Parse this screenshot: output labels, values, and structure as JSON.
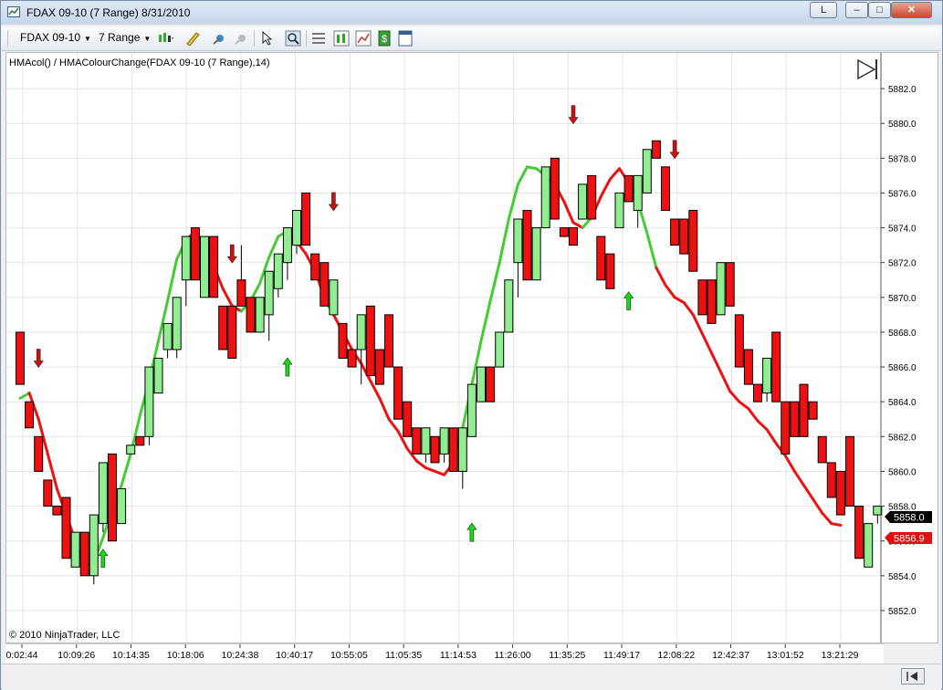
{
  "window": {
    "title": "FDAX 09-10 (7 Range)  8/31/2010",
    "buttons": {
      "link": "L",
      "minimize": "–",
      "maximize": "□",
      "close": "✕"
    }
  },
  "toolbar": {
    "instrument": "FDAX 09-10",
    "period": "7 Range",
    "icons": [
      "chart-style-icon",
      "drawing-tool-icon",
      "crosshair-icon",
      "global-crosshair-icon",
      "pointer-icon",
      "zoom-icon",
      "properties-icon",
      "indicators-icon",
      "strategies-icon",
      "orders-icon",
      "data-box-icon"
    ]
  },
  "chart": {
    "indicator_label": "HMAcol() / HMAColourChange(FDAX 09-10 (7 Range),14)",
    "copyright": "© 2010 NinjaTrader, LLC",
    "last_price_label": "5858.0",
    "indicator_price_label": "5856.9",
    "colors": {
      "bull": "#90ee90",
      "bear": "#ee1111",
      "hma_up": "#44cc33",
      "hma_down": "#ee1111",
      "up_arrow": "#11dd11",
      "down_arrow": "#cc1111"
    }
  },
  "chart_data": {
    "type": "candlestick",
    "ylim": [
      5851,
      5883
    ],
    "yticks": [
      "5852.0",
      "5854.0",
      "5856.0",
      "5858.0",
      "5860.0",
      "5862.0",
      "5864.0",
      "5866.0",
      "5868.0",
      "5870.0",
      "5872.0",
      "5874.0",
      "5876.0",
      "5878.0",
      "5880.0",
      "5882.0"
    ],
    "xticks": [
      "0:02:44",
      "10:09:26",
      "10:14:35",
      "10:18:06",
      "10:24:38",
      "10:40:17",
      "10:55:05",
      "11:05:35",
      "11:14:53",
      "11:26:00",
      "11:35:25",
      "11:49:17",
      "12:08:22",
      "12:42:37",
      "13:01:52",
      "13:21:29"
    ],
    "candles": [
      [
        5868,
        5868,
        5865,
        5865
      ],
      [
        5864,
        5864,
        5862.5,
        5862.5
      ],
      [
        5862,
        5862,
        5860,
        5860
      ],
      [
        5859.5,
        5859.5,
        5858,
        5858
      ],
      [
        5858,
        5858,
        5857.5,
        5857.5
      ],
      [
        5858.5,
        5858.5,
        5855,
        5855
      ],
      [
        5854.5,
        5856.5,
        5854.5,
        5856.5
      ],
      [
        5856.5,
        5856.5,
        5854,
        5854
      ],
      [
        5854,
        5857.5,
        5853.5,
        5857.5
      ],
      [
        5857,
        5860.5,
        5856.5,
        5860.5
      ],
      [
        5861,
        5861,
        5856,
        5856
      ],
      [
        5857,
        5859,
        5857,
        5859
      ],
      [
        5861,
        5861.5,
        5861,
        5861.5
      ],
      [
        5862,
        5862,
        5861.5,
        5861.5
      ],
      [
        5862,
        5866,
        5861.5,
        5866
      ],
      [
        5864.5,
        5866.5,
        5864.5,
        5866.5
      ],
      [
        5867,
        5868.5,
        5866.5,
        5868.5
      ],
      [
        5867,
        5870,
        5866.5,
        5870
      ],
      [
        5871,
        5873.5,
        5869.5,
        5873.5
      ],
      [
        5874,
        5874,
        5871,
        5871
      ],
      [
        5870,
        5873.5,
        5870,
        5873.5
      ],
      [
        5873.5,
        5873.5,
        5870,
        5870
      ],
      [
        5869.5,
        5869.5,
        5867,
        5867
      ],
      [
        5869.5,
        5869.5,
        5866.5,
        5866.5
      ],
      [
        5871,
        5873,
        5869.5,
        5869.5
      ],
      [
        5870,
        5870,
        5868,
        5868
      ],
      [
        5868,
        5870,
        5868,
        5870
      ],
      [
        5869,
        5871.5,
        5867.5,
        5871.5
      ],
      [
        5870.5,
        5872.5,
        5870,
        5872.5
      ],
      [
        5872,
        5874,
        5871,
        5874
      ],
      [
        5873,
        5875,
        5872.5,
        5875
      ],
      [
        5876,
        5876,
        5873,
        5873
      ],
      [
        5872.5,
        5872.5,
        5871,
        5871
      ],
      [
        5872,
        5872,
        5869.5,
        5869.5
      ],
      [
        5869,
        5871,
        5869,
        5871
      ],
      [
        5868.5,
        5868.5,
        5866.5,
        5866.5
      ],
      [
        5867,
        5867,
        5866,
        5866
      ],
      [
        5867,
        5869,
        5865,
        5869
      ],
      [
        5869.5,
        5869.5,
        5865.5,
        5865.5
      ],
      [
        5867,
        5867,
        5865,
        5865
      ],
      [
        5869,
        5869,
        5866,
        5866
      ],
      [
        5866,
        5866,
        5863,
        5863
      ],
      [
        5864,
        5864,
        5862,
        5862
      ],
      [
        5862.5,
        5862.5,
        5861,
        5861
      ],
      [
        5861,
        5862.5,
        5860.5,
        5862.5
      ],
      [
        5862,
        5862,
        5860.5,
        5860.5
      ],
      [
        5861,
        5862.5,
        5860.5,
        5862.5
      ],
      [
        5862.5,
        5862.5,
        5860,
        5860
      ],
      [
        5860,
        5862.5,
        5859,
        5862.5
      ],
      [
        5862,
        5865,
        5862,
        5865
      ],
      [
        5864,
        5866,
        5864,
        5866
      ],
      [
        5866,
        5866,
        5864,
        5864
      ],
      [
        5866,
        5868,
        5866,
        5868
      ],
      [
        5868,
        5871,
        5868,
        5871
      ],
      [
        5872,
        5874.5,
        5870,
        5874.5
      ],
      [
        5875,
        5875,
        5871,
        5871
      ],
      [
        5871,
        5874,
        5871,
        5874
      ],
      [
        5874,
        5877.5,
        5874,
        5877.5
      ],
      [
        5878,
        5878,
        5874.5,
        5874.5
      ],
      [
        5874,
        5874,
        5873.5,
        5873.5
      ],
      [
        5874,
        5874,
        5873,
        5873
      ],
      [
        5874.5,
        5876.5,
        5874.5,
        5876.5
      ],
      [
        5877,
        5877,
        5874.5,
        5874.5
      ],
      [
        5873.5,
        5873.5,
        5871,
        5871
      ],
      [
        5872.5,
        5872.5,
        5870.5,
        5870.5
      ],
      [
        5874,
        5876,
        5874,
        5876
      ],
      [
        5877,
        5877,
        5875.5,
        5875.5
      ],
      [
        5875,
        5877,
        5874,
        5877
      ],
      [
        5876,
        5878.5,
        5876,
        5878.5
      ],
      [
        5879,
        5879,
        5878,
        5878
      ],
      [
        5877.5,
        5877.5,
        5875,
        5875
      ],
      [
        5874.5,
        5874.5,
        5873,
        5873
      ],
      [
        5874.5,
        5874.5,
        5872.5,
        5872.5
      ],
      [
        5875,
        5875,
        5871.5,
        5871.5
      ],
      [
        5871,
        5871,
        5869,
        5869
      ],
      [
        5871,
        5871,
        5868.5,
        5868.5
      ],
      [
        5869,
        5872,
        5869,
        5872
      ],
      [
        5872,
        5872,
        5869.5,
        5869.5
      ],
      [
        5869,
        5869,
        5866,
        5866
      ],
      [
        5867,
        5867,
        5865,
        5865
      ],
      [
        5865,
        5865,
        5864,
        5864
      ],
      [
        5864.5,
        5866.5,
        5864,
        5866.5
      ],
      [
        5868,
        5868,
        5864,
        5864
      ],
      [
        5864,
        5864,
        5861,
        5861
      ],
      [
        5864,
        5864,
        5862,
        5862
      ],
      [
        5865,
        5865,
        5862,
        5862
      ],
      [
        5864,
        5864,
        5863,
        5863
      ],
      [
        5862,
        5862,
        5860.5,
        5860.5
      ],
      [
        5860.5,
        5860.5,
        5858.5,
        5858.5
      ],
      [
        5860,
        5860,
        5857.5,
        5857.5
      ],
      [
        5862,
        5862,
        5858,
        5858
      ],
      [
        5858,
        5858,
        5855,
        5855
      ],
      [
        5854.5,
        5857,
        5854.5,
        5857
      ],
      [
        5857.5,
        5858,
        5857,
        5858
      ]
    ],
    "hma_up_segments": [
      [
        0,
        1
      ],
      [
        7,
        18
      ],
      [
        24,
        29
      ],
      [
        47,
        57
      ],
      [
        61,
        62
      ],
      [
        66,
        69
      ]
    ],
    "hma": [
      5864.2,
      5864.5,
      5863,
      5861,
      5859,
      5857.5,
      5856,
      5854.5,
      5854.8,
      5856.2,
      5857.8,
      5859.2,
      5861,
      5863.2,
      5865.2,
      5867.5,
      5869.8,
      5872.2,
      5873.3,
      5873.8,
      5873,
      5871.8,
      5870.5,
      5869.5,
      5869.2,
      5869.8,
      5870.8,
      5872.3,
      5873.5,
      5873.8,
      5873.2,
      5872.5,
      5871.5,
      5870,
      5869,
      5868,
      5867,
      5866.2,
      5865.2,
      5864.2,
      5863,
      5862.3,
      5861.3,
      5860.6,
      5860.2,
      5860,
      5859.8,
      5860.5,
      5862.5,
      5865,
      5867.5,
      5869.8,
      5872,
      5874.5,
      5876.5,
      5877.5,
      5877.4,
      5877,
      5876.5,
      5875.5,
      5874.3,
      5874,
      5874.6,
      5875.8,
      5876.8,
      5877.4,
      5876.6,
      5875.5,
      5873.7,
      5871.7,
      5870.7,
      5870,
      5869.7,
      5869,
      5867.9,
      5866.8,
      5865.7,
      5864.6,
      5864,
      5863.6,
      5862.9,
      5862.4,
      5861.6,
      5860.9,
      5860,
      5859.2,
      5858.4,
      5857.6,
      5857,
      5856.9
    ],
    "signals": [
      {
        "type": "down",
        "bar": 2,
        "price": 5866.5
      },
      {
        "type": "up",
        "bar": 9,
        "price": 5855
      },
      {
        "type": "down",
        "bar": 23,
        "price": 5872.5
      },
      {
        "type": "up",
        "bar": 29,
        "price": 5866
      },
      {
        "type": "down",
        "bar": 34,
        "price": 5875.5
      },
      {
        "type": "up",
        "bar": 49,
        "price": 5856.5
      },
      {
        "type": "down",
        "bar": 60,
        "price": 5880.5
      },
      {
        "type": "up",
        "bar": 66,
        "price": 5869.8
      },
      {
        "type": "down",
        "bar": 71,
        "price": 5878.5
      }
    ]
  }
}
